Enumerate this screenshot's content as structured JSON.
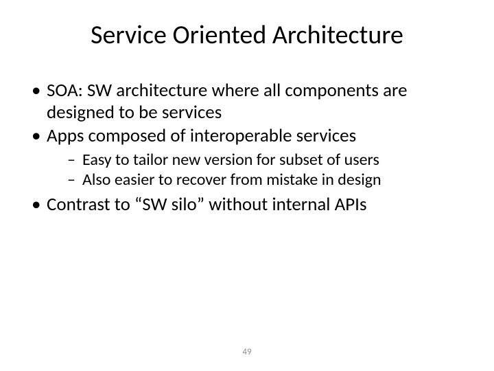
{
  "title": "Service Oriented Architecture",
  "bullets": {
    "b1": "SOA: SW architecture where all components are designed to be services",
    "b2": "Apps composed of interoperable services",
    "b2_sub": {
      "s1": "Easy to tailor new version for subset of users",
      "s2": "Also easier to recover from mistake in design"
    },
    "b3": "Contrast to “SW silo” without internal APIs"
  },
  "page_number": "49"
}
